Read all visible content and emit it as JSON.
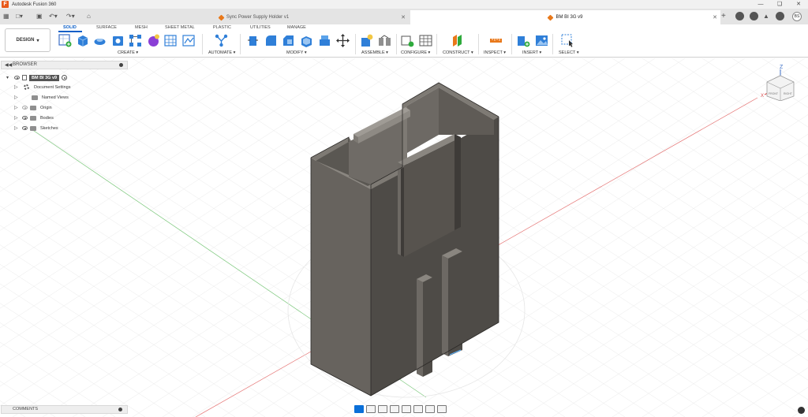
{
  "app": {
    "title": "Autodesk Fusion 360",
    "logo_letter": "F"
  },
  "tabs": [
    {
      "label": "Sync Power Supply Holder v1",
      "active": false
    },
    {
      "label": "BM BI 3G v9",
      "active": true
    }
  ],
  "user": {
    "initials": "BS"
  },
  "workspace": {
    "label": "DESIGN"
  },
  "ribbon_tabs": [
    "SOLID",
    "SURFACE",
    "MESH",
    "SHEET METAL",
    "PLASTIC",
    "UTILITIES",
    "MANAGE"
  ],
  "active_ribbon_tab": "SOLID",
  "groups": {
    "create": "CREATE",
    "automate": "AUTOMATE",
    "modify": "MODIFY",
    "assemble": "ASSEMBLE",
    "configure": "CONFIGURE",
    "construct": "CONSTRUCT",
    "inspect": "INSPECT",
    "insert": "INSERT",
    "select": "SELECT"
  },
  "browser": {
    "title": "BROWSER",
    "root": "BM BI 3G v9",
    "items": [
      {
        "label": "Document Settings",
        "icon": "gear-icon"
      },
      {
        "label": "Named Views",
        "icon": "folder-icon"
      },
      {
        "label": "Origin",
        "icon": "folder-icon",
        "eye_dimmed": true
      },
      {
        "label": "Bodies",
        "icon": "folder-icon"
      },
      {
        "label": "Sketches",
        "icon": "folder-icon"
      }
    ]
  },
  "comments": {
    "label": "COMMENTS"
  },
  "viewcube": {
    "z_label": "Z",
    "x_label": "X",
    "face_front": "FRONT",
    "face_right": "RIGHT"
  },
  "colors": {
    "accent": "#0a5ec7",
    "model_dark": "#4e4b47",
    "model_mid": "#67635e",
    "model_light": "#7e7a74",
    "axis_red": "#e57373",
    "axis_green": "#7ac77a",
    "brand": "#e8591a"
  }
}
